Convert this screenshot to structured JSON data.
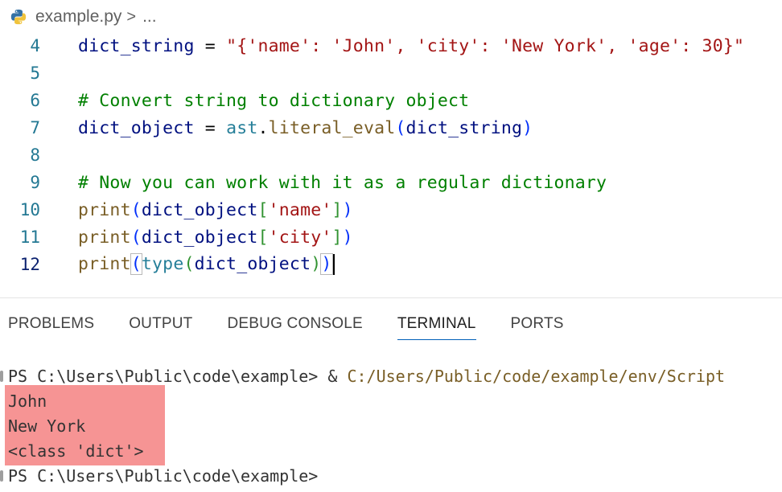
{
  "breadcrumb": {
    "file_icon": "python-icon",
    "file_name": "example.py",
    "separator": ">",
    "ellipsis": "..."
  },
  "editor": {
    "lines": [
      {
        "number": "4",
        "text": "dict_string = \"{'name': 'John', 'city': 'New York', 'age': 30}\""
      },
      {
        "number": "5",
        "text": ""
      },
      {
        "number": "6",
        "text": "# Convert string to dictionary object"
      },
      {
        "number": "7",
        "text": "dict_object = ast.literal_eval(dict_string)"
      },
      {
        "number": "8",
        "text": ""
      },
      {
        "number": "9",
        "text": "# Now you can work with it as a regular dictionary"
      },
      {
        "number": "10",
        "text": "print(dict_object['name'])"
      },
      {
        "number": "11",
        "text": "print(dict_object['city'])"
      },
      {
        "number": "12",
        "text": "print(type(dict_object))"
      }
    ],
    "active_line": "12"
  },
  "panel": {
    "tabs": [
      "PROBLEMS",
      "OUTPUT",
      "DEBUG CONSOLE",
      "TERMINAL",
      "PORTS"
    ],
    "active_tab": "TERMINAL"
  },
  "terminal": {
    "prompt1": "PS C:\\Users\\Public\\code\\example> ",
    "amp": "& ",
    "command_path": "C:/Users/Public/code/example/env/Script",
    "output": [
      "John",
      "New York",
      "<class 'dict'>"
    ],
    "prompt2": "PS C:\\Users\\Public\\code\\example>"
  },
  "colors": {
    "highlight": "#f58e8e",
    "keyword_string": "#a31515",
    "comment": "#008000",
    "function": "#795e26",
    "variable": "#001080"
  }
}
